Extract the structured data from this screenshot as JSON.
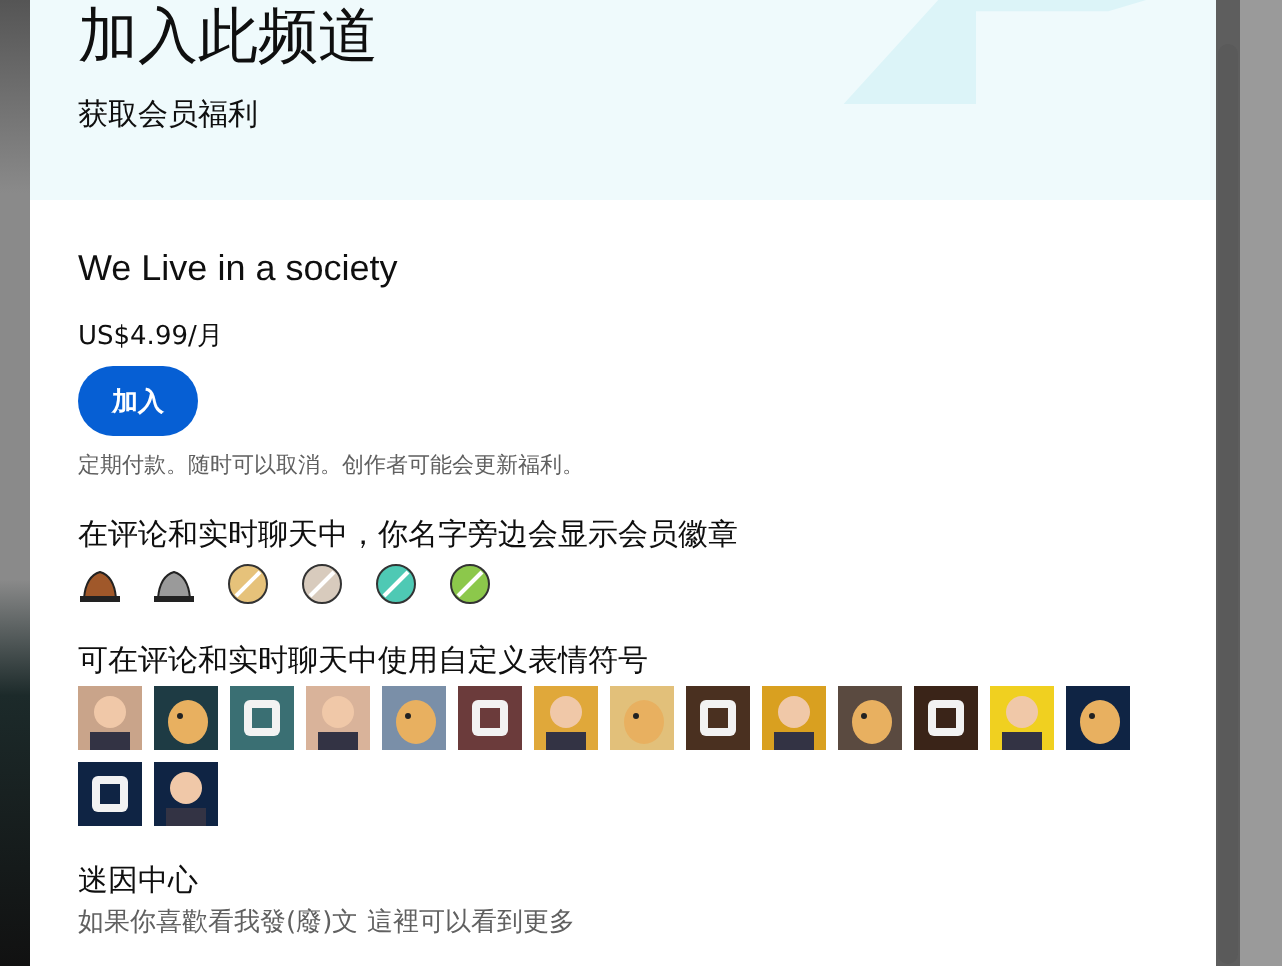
{
  "dialog": {
    "title": "加入此频道",
    "subtitle": "获取会员福利",
    "tier_name": "We Live in a society",
    "price": "US$4.99/月",
    "join_button": "加入",
    "note": "定期付款。随时可以取消。创作者可能会更新福利。"
  },
  "perks": [
    {
      "kind": "badges",
      "title": "在评论和实时聊天中，你名字旁边会显示会员徽章",
      "items": [
        {
          "color": "#a0582a"
        },
        {
          "color": "#9a9a9a"
        },
        {
          "color": "#e6c27a"
        },
        {
          "color": "#d8cbbd"
        },
        {
          "color": "#4ec9b4"
        },
        {
          "color": "#8cc84b"
        }
      ]
    },
    {
      "kind": "emotes",
      "title": "可在评论和实时聊天中使用自定义表情符号",
      "items": [
        {
          "color": "#c9a48a"
        },
        {
          "color": "#1e3b44"
        },
        {
          "color": "#3a6f73"
        },
        {
          "color": "#d9b39a"
        },
        {
          "color": "#7a8fa8"
        },
        {
          "color": "#6b3b3b"
        },
        {
          "color": "#e0a83a"
        },
        {
          "color": "#e2c07a"
        },
        {
          "color": "#4a3020"
        },
        {
          "color": "#d9a020"
        },
        {
          "color": "#5a4a40"
        },
        {
          "color": "#3a2418"
        },
        {
          "color": "#f0d020"
        },
        {
          "color": "#0f2444"
        },
        {
          "color": "#0f2444"
        },
        {
          "color": "#0f2444"
        }
      ]
    },
    {
      "kind": "text",
      "title": "迷因中心",
      "description": "如果你喜歡看我發(廢)文 這裡可以看到更多"
    }
  ]
}
